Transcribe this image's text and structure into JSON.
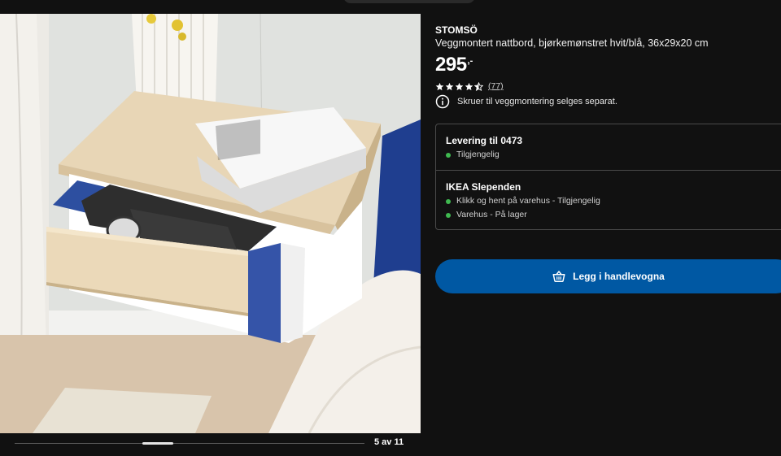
{
  "gallery": {
    "image_alt": "STOMSÖ veggmontert nattbord med åpen blå skuff",
    "counter": "5 av 11",
    "current": 5,
    "total": 11
  },
  "product": {
    "name": "STOMSÖ",
    "description": "Veggmontert nattbord, bjørkemønstret hvit/blå, 36x29x20 cm",
    "price_integer": "295",
    "price_decimal": ",-",
    "rating": 4.5,
    "review_count": "(77)",
    "note": "Skruer til veggmontering selges separat."
  },
  "availability": {
    "delivery": {
      "title": "Levering til 0473",
      "lines": [
        "Tilgjengelig"
      ]
    },
    "store": {
      "title": "IKEA Slependen",
      "lines": [
        "Klikk og hent på varehus - Tilgjengelig",
        "Varehus - På lager"
      ]
    },
    "status_color": "#3fb950"
  },
  "actions": {
    "add_to_cart_label": "Legg i handlevogna",
    "button_color": "#0058a3"
  },
  "icons": {
    "note": "info-icon",
    "cart": "shopping-basket-icon",
    "rating": "star-icon"
  }
}
